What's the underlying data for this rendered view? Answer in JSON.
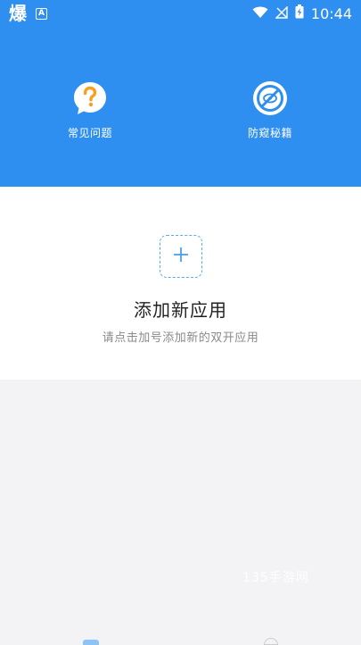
{
  "status_bar": {
    "app_glyph": "爆",
    "badge": "A",
    "time": "10:44",
    "icons": [
      "wifi-icon",
      "signal-off-icon",
      "battery-charging-icon"
    ]
  },
  "header": {
    "background": "#2f8ff0",
    "items": [
      {
        "icon": "question-bubble-icon",
        "label": "常见问题",
        "icon_color": "#f5a023"
      },
      {
        "icon": "no-ban-icon",
        "label": "防窥秘籍",
        "icon_color": "#2f8ff0"
      }
    ]
  },
  "add_app": {
    "title": "添加新应用",
    "hint": "请点击加号添加新的双开应用",
    "plus_color": "#4a9eea"
  },
  "watermark": "135手游网",
  "bottom_nav": {
    "tab_colors": [
      "#8ec3f5",
      "#cccccc"
    ]
  }
}
